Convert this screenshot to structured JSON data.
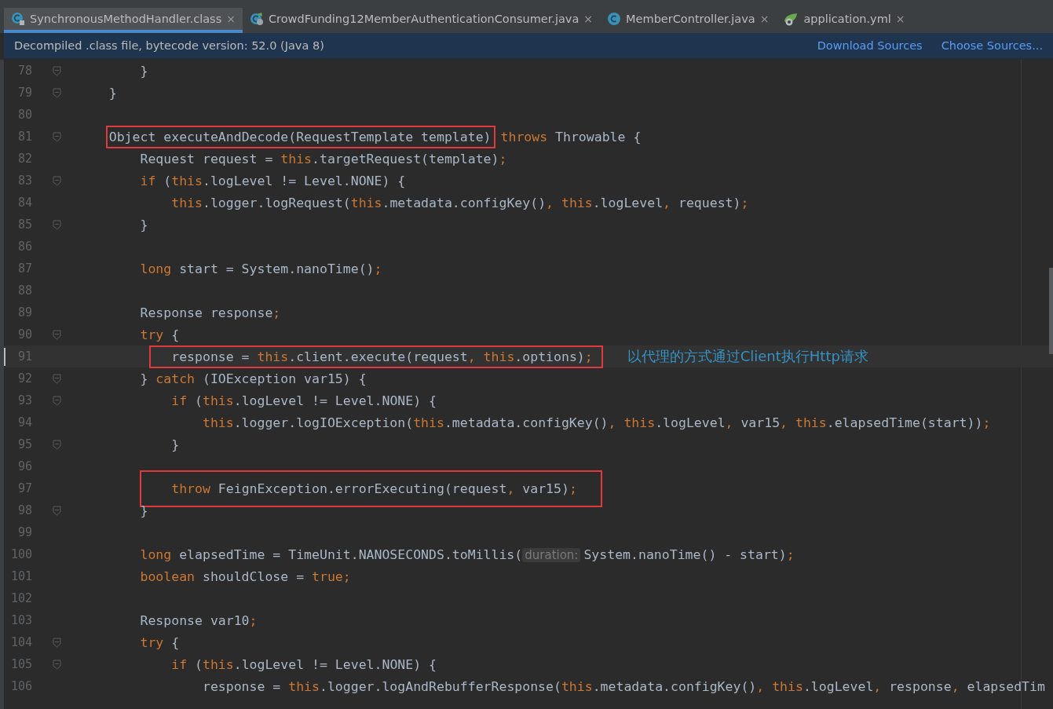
{
  "tabs": [
    {
      "label": "SynchronousMethodHandler.class",
      "close": "×",
      "kind": "compiled",
      "selected": true
    },
    {
      "label": "CrowdFunding12MemberAuthenticationConsumer.java",
      "close": "×",
      "kind": "spring-class",
      "selected": false
    },
    {
      "label": "MemberController.java",
      "close": "×",
      "kind": "class",
      "selected": false
    },
    {
      "label": "application.yml",
      "close": "×",
      "kind": "spring-config",
      "selected": false
    }
  ],
  "banner": {
    "message": "Decompiled .class file, bytecode version: 52.0 (Java 8)",
    "links": [
      "Download Sources",
      "Choose Sources..."
    ]
  },
  "editor": {
    "lines": [
      {
        "n": "78",
        "fold": true,
        "current": false,
        "tokens": [
          {
            "kind": "plain",
            "text": "        }"
          }
        ]
      },
      {
        "n": "79",
        "fold": true,
        "current": false,
        "tokens": [
          {
            "kind": "plain",
            "text": "    }"
          }
        ]
      },
      {
        "n": "80",
        "fold": false,
        "current": false
      },
      {
        "n": "81",
        "fold": true,
        "current": false,
        "boxed": [
          {
            "kind": "plain",
            "text": "    Object executeAndDecode(RequestTemplate template)"
          }
        ],
        "tokens": [
          {
            "kind": "keyword",
            "text": "throws"
          },
          {
            "kind": "plain",
            "text": " Throwable {"
          }
        ]
      },
      {
        "n": "82",
        "fold": false,
        "current": false,
        "tokens": [
          {
            "kind": "plain",
            "text": "        Request request = "
          },
          {
            "kind": "keyword",
            "text": "this"
          },
          {
            "kind": "plain",
            "text": ".targetRequest(template)"
          },
          {
            "kind": "keyword",
            "text": ";"
          }
        ]
      },
      {
        "n": "83",
        "fold": true,
        "current": false,
        "tokens": [
          {
            "kind": "keyword",
            "text": "        if"
          },
          {
            "kind": "plain",
            "text": " ("
          },
          {
            "kind": "keyword",
            "text": "this"
          },
          {
            "kind": "plain",
            "text": ".logLevel != Level.NONE) {"
          }
        ]
      },
      {
        "n": "84",
        "fold": false,
        "current": false,
        "tokens": [
          {
            "kind": "keyword",
            "text": "            this"
          },
          {
            "kind": "plain",
            "text": ".logger.logRequest("
          },
          {
            "kind": "keyword",
            "text": "this"
          },
          {
            "kind": "plain",
            "text": ".metadata.configKey()"
          },
          {
            "kind": "keyword",
            "text": ", this"
          },
          {
            "kind": "plain",
            "text": ".logLevel"
          },
          {
            "kind": "keyword",
            "text": ","
          },
          {
            "kind": "plain",
            "text": " request)"
          },
          {
            "kind": "keyword",
            "text": ";"
          }
        ]
      },
      {
        "n": "85",
        "fold": true,
        "current": false,
        "tokens": [
          {
            "kind": "plain",
            "text": "        }"
          }
        ]
      },
      {
        "n": "86",
        "fold": false,
        "current": false
      },
      {
        "n": "87",
        "fold": false,
        "current": false,
        "tokens": [
          {
            "kind": "keyword",
            "text": "        long"
          },
          {
            "kind": "plain",
            "text": " start = System.nanoTime()"
          },
          {
            "kind": "keyword",
            "text": ";"
          }
        ]
      },
      {
        "n": "88",
        "fold": false,
        "current": false
      },
      {
        "n": "89",
        "fold": false,
        "current": false,
        "tokens": [
          {
            "kind": "plain",
            "text": "        Response response"
          },
          {
            "kind": "keyword",
            "text": ";"
          }
        ]
      },
      {
        "n": "90",
        "fold": true,
        "current": false,
        "tokens": [
          {
            "kind": "keyword",
            "text": "        try"
          },
          {
            "kind": "plain",
            "text": " {"
          }
        ]
      },
      {
        "n": "91",
        "fold": false,
        "current": true,
        "boxed": [
          {
            "kind": "plain",
            "text": "            response = "
          },
          {
            "kind": "keyword",
            "text": "this"
          },
          {
            "kind": "plain",
            "text": ".client.execute(request"
          },
          {
            "kind": "keyword",
            "text": ", this"
          },
          {
            "kind": "plain",
            "text": ".options)"
          },
          {
            "kind": "keyword",
            "text": ";"
          }
        ],
        "note": "以代理的方式通过Client执行Http请求"
      },
      {
        "n": "92",
        "fold": true,
        "current": false,
        "tokens": [
          {
            "kind": "plain",
            "text": "        } "
          },
          {
            "kind": "keyword",
            "text": "catch"
          },
          {
            "kind": "plain",
            "text": " (IOException var15) {"
          }
        ]
      },
      {
        "n": "93",
        "fold": true,
        "current": false,
        "tokens": [
          {
            "kind": "keyword",
            "text": "            if"
          },
          {
            "kind": "plain",
            "text": " ("
          },
          {
            "kind": "keyword",
            "text": "this"
          },
          {
            "kind": "plain",
            "text": ".logLevel != Level.NONE) {"
          }
        ]
      },
      {
        "n": "94",
        "fold": false,
        "current": false,
        "tokens": [
          {
            "kind": "keyword",
            "text": "                this"
          },
          {
            "kind": "plain",
            "text": ".logger.logIOException("
          },
          {
            "kind": "keyword",
            "text": "this"
          },
          {
            "kind": "plain",
            "text": ".metadata.configKey()"
          },
          {
            "kind": "keyword",
            "text": ", this"
          },
          {
            "kind": "plain",
            "text": ".logLevel"
          },
          {
            "kind": "keyword",
            "text": ","
          },
          {
            "kind": "plain",
            "text": " var15"
          },
          {
            "kind": "keyword",
            "text": ", this"
          },
          {
            "kind": "plain",
            "text": ".elapsedTime(start))"
          },
          {
            "kind": "keyword",
            "text": ";"
          }
        ]
      },
      {
        "n": "95",
        "fold": true,
        "current": false,
        "tokens": [
          {
            "kind": "plain",
            "text": "            }"
          }
        ]
      },
      {
        "n": "96",
        "fold": false,
        "current": false
      },
      {
        "n": "97",
        "fold": false,
        "current": false,
        "boxed": [
          {
            "kind": "keyword",
            "text": "            throw"
          },
          {
            "kind": "plain",
            "text": " FeignException.errorExecuting(request"
          },
          {
            "kind": "keyword",
            "text": ","
          },
          {
            "kind": "plain",
            "text": " var15)"
          },
          {
            "kind": "keyword",
            "text": ";"
          }
        ]
      },
      {
        "n": "98",
        "fold": true,
        "current": false,
        "tokens": [
          {
            "kind": "plain",
            "text": "        }"
          }
        ]
      },
      {
        "n": "99",
        "fold": false,
        "current": false
      },
      {
        "n": "100",
        "fold": false,
        "current": false,
        "tokens": [
          {
            "kind": "keyword",
            "text": "        long"
          },
          {
            "kind": "plain",
            "text": " elapsedTime = TimeUnit.NANOSECONDS.toMillis("
          },
          {
            "kind": "hint",
            "text": "duration:"
          },
          {
            "kind": "plain",
            "text": "System.nanoTime() - start)"
          },
          {
            "kind": "keyword",
            "text": ";"
          }
        ]
      },
      {
        "n": "101",
        "fold": false,
        "current": false,
        "tokens": [
          {
            "kind": "keyword",
            "text": "        boolean"
          },
          {
            "kind": "plain",
            "text": " shouldClose = "
          },
          {
            "kind": "keyword",
            "text": "true;"
          }
        ]
      },
      {
        "n": "102",
        "fold": false,
        "current": false
      },
      {
        "n": "103",
        "fold": false,
        "current": false,
        "tokens": [
          {
            "kind": "plain",
            "text": "        Response var10"
          },
          {
            "kind": "keyword",
            "text": ";"
          }
        ]
      },
      {
        "n": "104",
        "fold": true,
        "current": false,
        "tokens": [
          {
            "kind": "keyword",
            "text": "        try"
          },
          {
            "kind": "plain",
            "text": " {"
          }
        ]
      },
      {
        "n": "105",
        "fold": true,
        "current": false,
        "tokens": [
          {
            "kind": "keyword",
            "text": "            if"
          },
          {
            "kind": "plain",
            "text": " ("
          },
          {
            "kind": "keyword",
            "text": "this"
          },
          {
            "kind": "plain",
            "text": ".logLevel != Level.NONE) {"
          }
        ]
      },
      {
        "n": "106",
        "fold": false,
        "current": false,
        "tokens": [
          {
            "kind": "plain",
            "text": "                response = "
          },
          {
            "kind": "keyword",
            "text": "this"
          },
          {
            "kind": "plain",
            "text": ".logger.logAndRebufferResponse("
          },
          {
            "kind": "keyword",
            "text": "this"
          },
          {
            "kind": "plain",
            "text": ".metadata.configKey()"
          },
          {
            "kind": "keyword",
            "text": ", this"
          },
          {
            "kind": "plain",
            "text": ".logLevel"
          },
          {
            "kind": "keyword",
            "text": ","
          },
          {
            "kind": "plain",
            "text": " response"
          },
          {
            "kind": "keyword",
            "text": ","
          },
          {
            "kind": "plain",
            "text": " elapsedTim"
          }
        ]
      }
    ]
  }
}
